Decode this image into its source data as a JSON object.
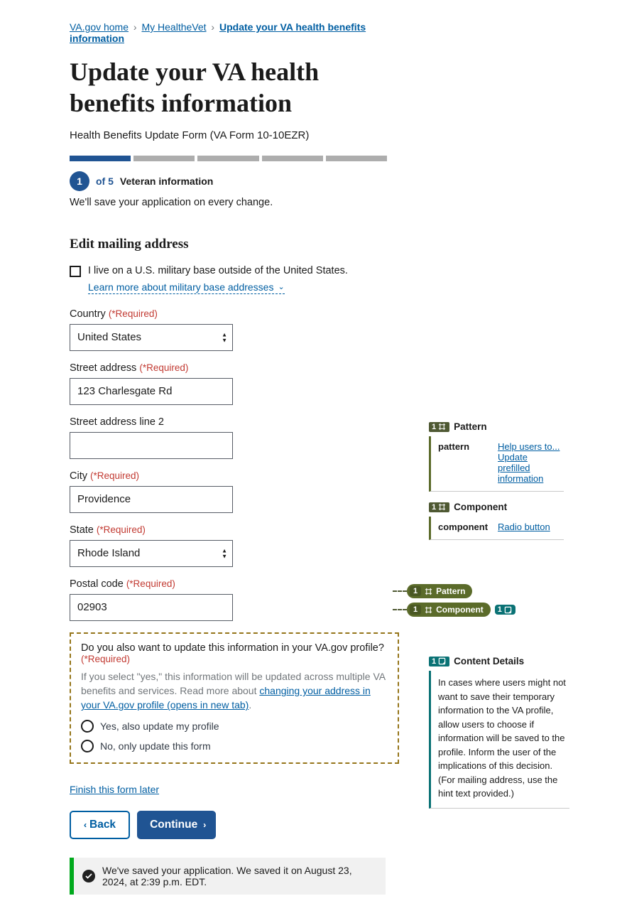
{
  "breadcrumb": {
    "items": [
      "VA.gov home",
      "My HealtheVet",
      "Update your VA health benefits information"
    ]
  },
  "page": {
    "title": "Update your VA health benefits information",
    "subtitle": "Health Benefits Update Form (VA Form 10-10EZR)"
  },
  "progress": {
    "current_num": "1",
    "of_text": "of 5",
    "step_label": "Veteran information",
    "autosave": "We'll save your application on every change."
  },
  "section_title": "Edit mailing address",
  "military_base": {
    "checkbox_label": "I live on a U.S. military base outside of the United States.",
    "learn_more": "Learn more about military base addresses"
  },
  "required_text": "(*Required)",
  "fields": {
    "country": {
      "label": "Country",
      "value": "United States"
    },
    "street1": {
      "label": "Street address",
      "value": "123 Charlesgate Rd"
    },
    "street2": {
      "label": "Street address line 2",
      "value": ""
    },
    "city": {
      "label": "City",
      "value": "Providence"
    },
    "state": {
      "label": "State",
      "value": "Rhode Island"
    },
    "postal": {
      "label": "Postal code",
      "value": "02903"
    }
  },
  "profile_question": {
    "question": "Do you also want to update this information in your VA.gov profile?",
    "hint_prefix": "If you select \"yes,\" this information will be updated across multiple VA benefits and services. Read more about ",
    "hint_link": "changing your address in your VA.gov profile (opens in new tab)",
    "hint_suffix": ".",
    "option_yes": "Yes, also update my profile",
    "option_no": "No, only update this form"
  },
  "finish_later": "Finish this form later",
  "buttons": {
    "back": "Back",
    "continue": "Continue"
  },
  "alert": {
    "text": "We've saved your application. We saved it on August 23, 2024, at 2:39 p.m. EDT."
  },
  "anno_pattern": {
    "tag": "1",
    "title": "Pattern",
    "key": "pattern",
    "link": "Help users to... Update prefilled information"
  },
  "anno_component": {
    "tag": "1",
    "title": "Component",
    "key": "component",
    "link": "Radio button"
  },
  "pill_pattern": {
    "num": "1",
    "label": "Pattern"
  },
  "pill_component": {
    "num": "1",
    "label": "Component"
  },
  "pill_teal": {
    "num": "1"
  },
  "anno_content": {
    "tag": "1",
    "title": "Content Details",
    "body": "In cases where users might not want to save their temporary information to the VA profile, allow users to choose if information will be saved to the profile. Inform the user of the implications of this decision. (For mailing address, use the hint text provided.)"
  }
}
